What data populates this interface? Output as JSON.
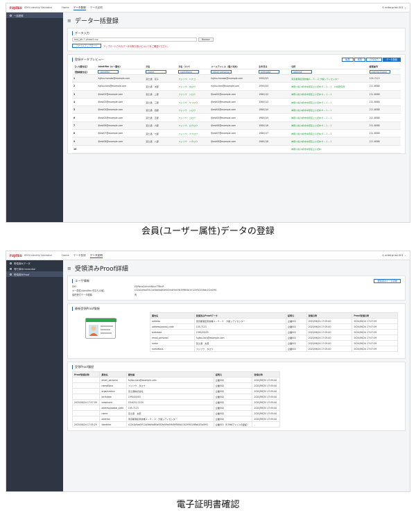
{
  "header": {
    "brand": "FUJITSU",
    "app_name": "IDYX Identity Validator",
    "user": "enterprise-001"
  },
  "screen1": {
    "nav": [
      "Home",
      "データ登録",
      "データ証明"
    ],
    "sidebar": [
      "一括登録"
    ],
    "title": "データ一括登録",
    "input_section": "データ入力",
    "file_name": "test_jcb-7-phase2.csv",
    "browse": "Browse",
    "upload": "ファイルアップロード",
    "upload_note": "アップロードされたデータの取り扱いについてをご確認ください。",
    "preview_section": "登録データプレビュー",
    "buttons": [
      "編集",
      "削除",
      "CSV出力",
      "データ登録"
    ],
    "columns": [
      "【入力属性名】",
      "identifier (キー属性)",
      "氏名",
      "氏名（カナ）",
      "メールアドレス（個人利用）",
      "生年月日",
      "住所",
      "郵便番号"
    ],
    "mapping": [
      "【登録属性名】",
      "identifier",
      "name",
      "nameKana",
      "email_personal",
      "birthdate",
      "address",
      "address/postal_"
    ],
    "rows": [
      {
        "n": "1",
        "id": "fujitsu.hanako@example.com",
        "name": "富士通　花子",
        "kana": "フジツウ　ハナコ",
        "email": "fujitsu.hanako@example.com",
        "birth": "1990/3/3",
        "addr": "東京都港区東新橋１－５－２ 汐留シティセンター",
        "zip": "105-7123"
      },
      {
        "n": "2",
        "id": "fujitsu.taro@example.com",
        "name": "富士通　太郎",
        "kana": "フジツウ　タロウ",
        "email": "fujitsu.taro@example.com",
        "birth": "1990/3/5",
        "addr": "神奈川県川崎市中原区上小田中４－１－１　川崎研究所",
        "zip": "211-8588"
      },
      {
        "n": "3",
        "id": "fjtest02@example.com",
        "name": "富士通　二郎",
        "kana": "フジツウ　ジロウ",
        "email": "fjtest02@example.com",
        "birth": "1980/1/2",
        "addr": "神奈川県川崎市中原区上小田中４－１－１",
        "zip": "211-8588"
      },
      {
        "n": "4",
        "id": "fjtest03@example.com",
        "name": "富士通　三郎",
        "kana": "フジツウ　サブロウ",
        "email": "fjtest03@example.com",
        "birth": "1980/1/3",
        "addr": "神奈川県川崎市中原区上小田中４－１－１",
        "zip": "211-8588"
      },
      {
        "n": "5",
        "id": "fjtest04@example.com",
        "name": "富士通　四郎",
        "kana": "フジツウ　シロウ",
        "email": "fjtest04@example.com",
        "birth": "1980/1/4",
        "addr": "神奈川県川崎市中原区上小田中４－１－１",
        "zip": "211-8588"
      },
      {
        "n": "6",
        "id": "fjtest05@example.com",
        "name": "富士通　五郎",
        "kana": "フジツウ　ゴロウ",
        "email": "fjtest05@example.com",
        "birth": "1980/1/5",
        "addr": "神奈川県川崎市中原区上小田中４－１－１",
        "zip": "211-8588"
      },
      {
        "n": "7",
        "id": "fjtest06@example.com",
        "name": "富士通　六郎",
        "kana": "フジツウ　ロクロウ",
        "email": "fjtest06@example.com",
        "birth": "1980/1/6",
        "addr": "神奈川県川崎市中原区上小田中４－１－１",
        "zip": "211-8588"
      },
      {
        "n": "8",
        "id": "fjtest07@example.com",
        "name": "富士通　七郎",
        "kana": "フジツウ　ナナロウ",
        "email": "fjtest07@example.com",
        "birth": "1980/1/7",
        "addr": "神奈川県川崎市中原区上小田中４－１－１",
        "zip": "211-8588"
      },
      {
        "n": "9",
        "id": "fjtest08@example.com",
        "name": "富士通　八郎",
        "kana": "フジツウ　ハチロウ",
        "email": "fjtest08@example.com",
        "birth": "1980/1/8",
        "addr": "神奈川県川崎市中原区上小田中４－１－１",
        "zip": "211-8588"
      },
      {
        "n": "10",
        "id": "",
        "name": "",
        "kana": "",
        "email": "",
        "birth": "",
        "addr": "神奈川県川崎市中原区上小田中",
        "zip": ""
      }
    ],
    "caption": "会員(ユーザー属性)データの登録"
  },
  "screen2": {
    "nav": [
      "Home",
      "データ登録",
      "データ証明"
    ],
    "sidebar": [
      "受領済みデータ",
      "発行済みCredential",
      "受領済みProof"
    ],
    "title": "受領済みProof詳細",
    "user_section": "ユーザ情報",
    "registered_btn": "登録済みデータ詳細",
    "user_info": [
      {
        "k": "DID",
        "v": "EDPanoSuhsnhNkroTTBiuR"
      },
      {
        "k": "キー属性(identifier 的なもの値)",
        "v": "c22a1b9ad5911b5bb9a8f4e0f2fe4f9e5ffc3fff6f4b10125f50256eb1f2a0f91"
      },
      {
        "k": "最終受付データ種類",
        "v": "有"
      }
    ],
    "latest_section": "最新受領Proof情報",
    "latest_cols": [
      "属性名",
      "受領済みProofデータ",
      "証明元",
      "受領日時",
      "Proof受領日時"
    ],
    "latest_rows": [
      [
        "address",
        "東京都港区東新橋１－５－２　汐留シティセンター",
        "企業002",
        "2020/06/24 17:05:40",
        "2020/06/24 17:07:09"
      ],
      [
        "address/postal_code",
        "105-7123",
        "企業002",
        "2020/06/24 17:05:40",
        "2020/06/24 17:07:09"
      ],
      [
        "birthdate",
        "1990/03/03",
        "企業002",
        "2020/06/24 17:05:40",
        "2020/06/24 17:07:09"
      ],
      [
        "email_personal",
        "fujitsu.taro@example.com",
        "企業002",
        "2020/06/24 17:05:40",
        "2020/06/24 17:07:09"
      ],
      [
        "name",
        "富士通　太郎",
        "企業002",
        "2020/06/24 17:05:40",
        "2020/06/24 17:07:09"
      ],
      [
        "nameKana",
        "フジツウ　タロウ",
        "企業002",
        "2020/06/24 17:05:40",
        "2020/06/24 17:07:09"
      ]
    ],
    "history_section": "受領Proof履歴",
    "history_cols": [
      "Proof受領日時",
      "属性名",
      "属性値",
      "証明元",
      "受領日時"
    ],
    "history_rows": [
      [
        "",
        "email_personal",
        "fujitsu.taro@example.com",
        "企業002",
        "2020/06/24 17:05:40"
      ],
      [
        "",
        "nameKana",
        "フジツウ　タロウ",
        "企業002",
        "2020/06/24 17:05:40"
      ],
      [
        "",
        "organization",
        "富士通株式会社",
        "企業002",
        "2020/06/24 17:05:40"
      ],
      [
        "",
        "birthdate",
        "1990/03/03",
        "企業002",
        "2020/06/24 17:05:40"
      ],
      [
        "2020/06/24 17:07:09",
        "telephone",
        "03-6252-2220",
        "企業002",
        "2020/06/24 17:05:40"
      ],
      [
        "",
        "address/postal_code",
        "105-7123",
        "企業002",
        "2020/06/24 17:05:40"
      ],
      [
        "",
        "name",
        "富士通　太郎",
        "企業002",
        "2020/06/24 17:05:40"
      ],
      [
        "",
        "address",
        "東京都港区東新橋１－５－２　汐留シティセンター",
        "企業002",
        "2020/06/24 17:05:40"
      ],
      [
        "2020/06/24 17:05:29",
        "identifier",
        "c22a1b9ad5911b5bb9a8f4e0f2fe4f9e5ffc3fff6f4b10125f50256eb1f2a0f91",
        "企業001（E-MailアドレスE認証）",
        "-"
      ]
    ],
    "caption": "電子証明書確認"
  }
}
